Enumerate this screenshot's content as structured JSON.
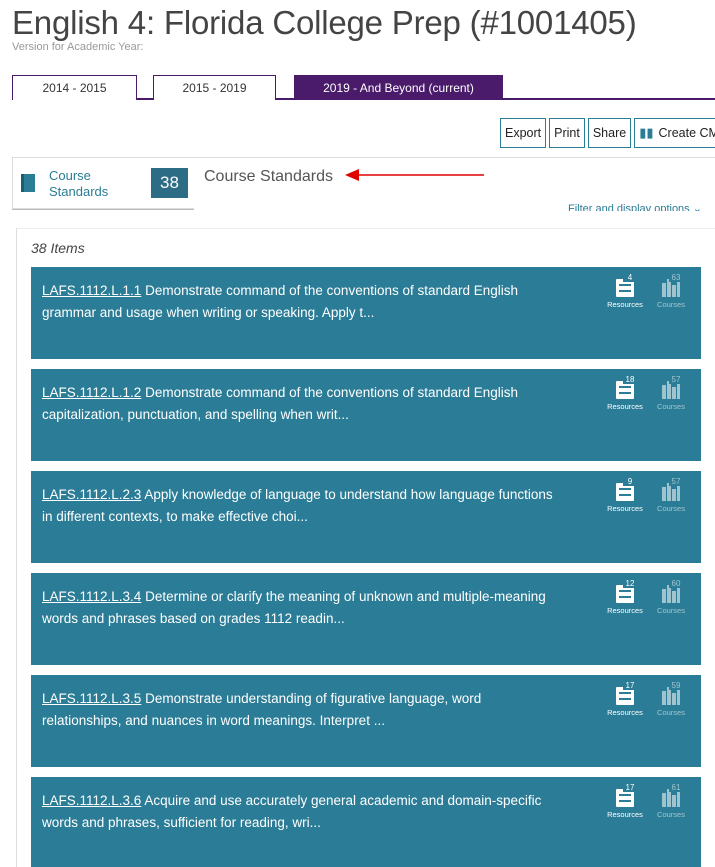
{
  "page": {
    "title": "English 4: Florida College Prep   (#1001405)",
    "year_label": "Version for Academic Year:"
  },
  "tabs": [
    {
      "label": "2014 - 2015",
      "active": false
    },
    {
      "label": "2015 - 2019",
      "active": false
    },
    {
      "label": "2019 - And Beyond (current)",
      "active": true
    }
  ],
  "toolbar": {
    "export": "Export",
    "print": "Print",
    "share": "Share",
    "create_cma": "Create CMA"
  },
  "sidebar": {
    "label": "Course Standards",
    "count": "38"
  },
  "section": {
    "title": "Course Standards",
    "filter_link": "Filter and display options",
    "items_count": "38 Items"
  },
  "icons": {
    "book": "book-icon",
    "map": "map-icon",
    "resources": "resources-icon",
    "courses": "courses-icon",
    "arrow": "red-arrow-icon",
    "chevron": "chevron-down-icon"
  },
  "colors": {
    "tab_active": "#4a1a6b",
    "card_bg": "#2b7c96",
    "accent": "#2a7d95",
    "arrow": "#e00000"
  },
  "labels": {
    "resources": "Resources",
    "courses": "Courses"
  },
  "standards": [
    {
      "code": "LAFS.1112.L.1.1",
      "text": "Demonstrate command of the conventions of standard English grammar and usage when writing or speaking. Apply t...",
      "resources": "4",
      "courses": "63"
    },
    {
      "code": "LAFS.1112.L.1.2",
      "text": "Demonstrate command of the conventions of standard English capitalization, punctuation, and spelling when writ...",
      "resources": "18",
      "courses": "57"
    },
    {
      "code": "LAFS.1112.L.2.3",
      "text": "Apply knowledge of language to understand how language functions in different contexts, to make effective choi...",
      "resources": "9",
      "courses": "57"
    },
    {
      "code": "LAFS.1112.L.3.4",
      "text": "Determine or clarify the meaning of unknown and multiple-meaning words and phrases based on grades 1112 readin...",
      "resources": "12",
      "courses": "60"
    },
    {
      "code": "LAFS.1112.L.3.5",
      "text": "Demonstrate understanding of figurative language, word relationships, and nuances in word meanings. Interpret ...",
      "resources": "17",
      "courses": "59"
    },
    {
      "code": "LAFS.1112.L.3.6",
      "text": "Acquire and use accurately general academic and domain-specific words and phrases, sufficient for reading, wri...",
      "resources": "17",
      "courses": "61"
    }
  ]
}
